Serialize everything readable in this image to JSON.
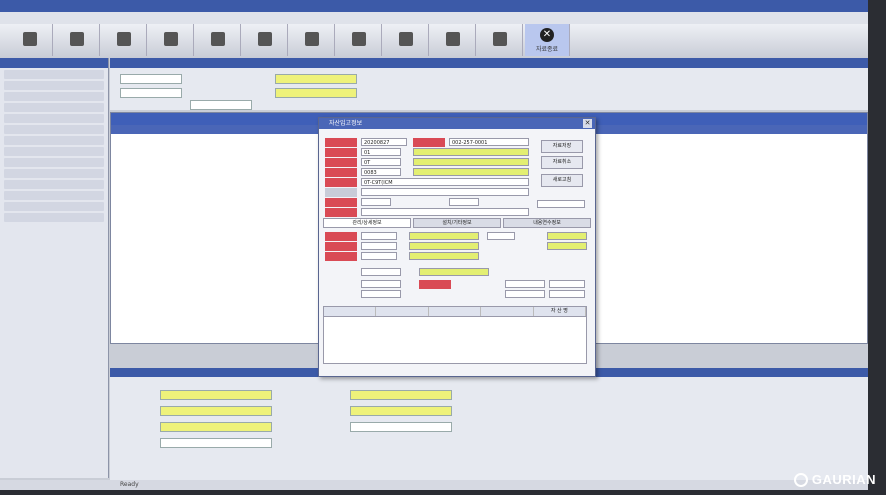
{
  "toolbar": {
    "close_label": "자료종료"
  },
  "dialog": {
    "title": "자산입고정보",
    "date_value": "20200827",
    "code_value": "002-257-0001",
    "field_values": [
      "01",
      "0T",
      "0083",
      "0T-C9T(ICM"
    ],
    "buttons": [
      "자료저장",
      "자료취소",
      "새로고침"
    ],
    "tabs": [
      "관리/상세정보",
      "설치/기타정보",
      "내용연수정보"
    ],
    "grid_header_note": "자 산 명"
  },
  "status": {
    "text": "Ready"
  },
  "watermark": {
    "text": "GAURIAN"
  },
  "colors": {
    "header_blue": "#3c5aa8",
    "required_red": "#d94a55",
    "input_yellow": "#e3ef72"
  }
}
